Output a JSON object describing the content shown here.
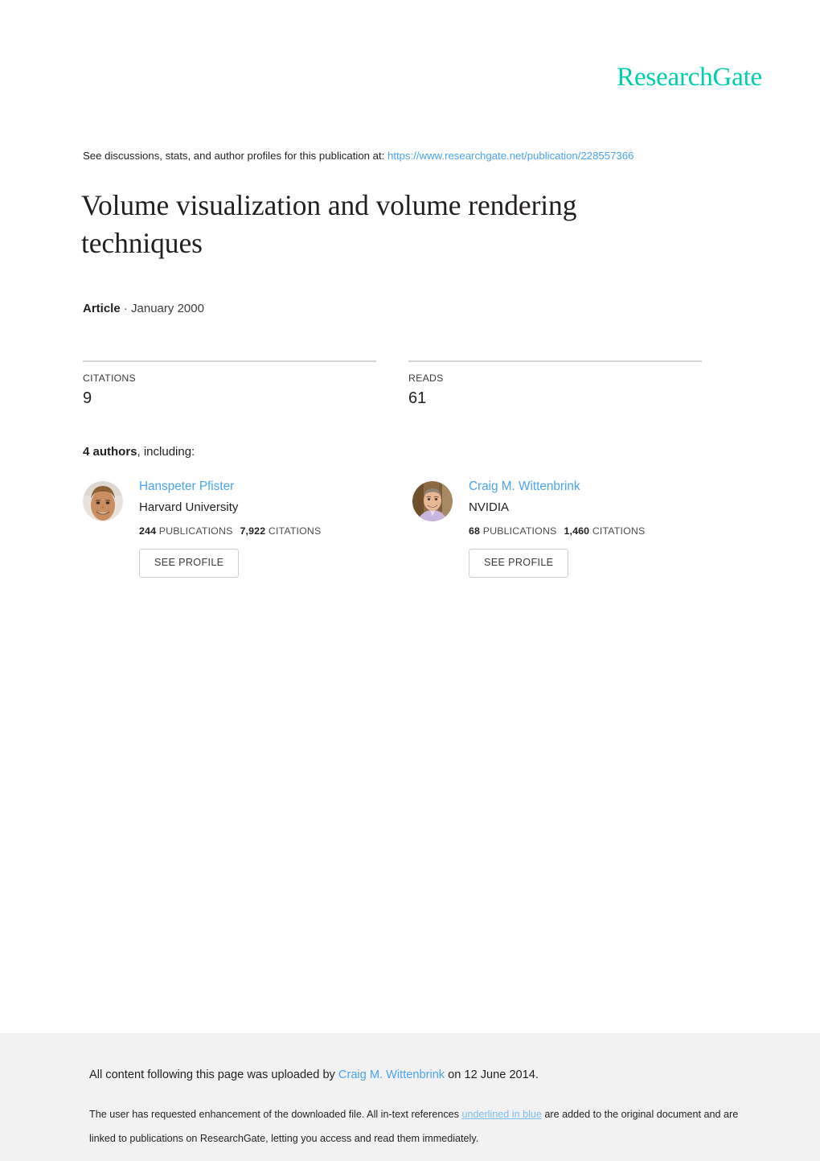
{
  "brand": {
    "name": "ResearchGate",
    "color": "#00cdac"
  },
  "header": {
    "discussions_prefix": "See discussions, stats, and author profiles for this publication at: ",
    "publication_url": "https://www.researchgate.net/publication/228557366",
    "link_color": "#4aa3f0"
  },
  "publication": {
    "title": "Volume visualization and volume rendering techniques",
    "type": "Article",
    "separator": "·",
    "date": "January 2000"
  },
  "stats": [
    {
      "label": "CITATIONS",
      "value": "9"
    },
    {
      "label": "READS",
      "value": "61"
    }
  ],
  "authors_section": {
    "count_label": "4 authors",
    "including_label": ", including:"
  },
  "authors": [
    {
      "name": "Hanspeter Pfister",
      "affiliation": "Harvard University",
      "publications_count": "244",
      "publications_label": "PUBLICATIONS",
      "citations_count": "7,922",
      "citations_label": "CITATIONS",
      "button_label": "SEE PROFILE"
    },
    {
      "name": "Craig M. Wittenbrink",
      "affiliation": "NVIDIA",
      "publications_count": "68",
      "publications_label": "PUBLICATIONS",
      "citations_count": "1,460",
      "citations_label": "CITATIONS",
      "button_label": "SEE PROFILE"
    }
  ],
  "footer": {
    "upload_prefix": "All content following this page was uploaded by ",
    "uploader": "Craig M. Wittenbrink",
    "upload_suffix": " on 12 June 2014.",
    "note_part1": "The user has requested enhancement of the downloaded file. All in-text references ",
    "note_highlight": "underlined in blue",
    "note_part2": " are added to the original document and are linked to publications on ResearchGate, letting you access and read them immediately."
  }
}
